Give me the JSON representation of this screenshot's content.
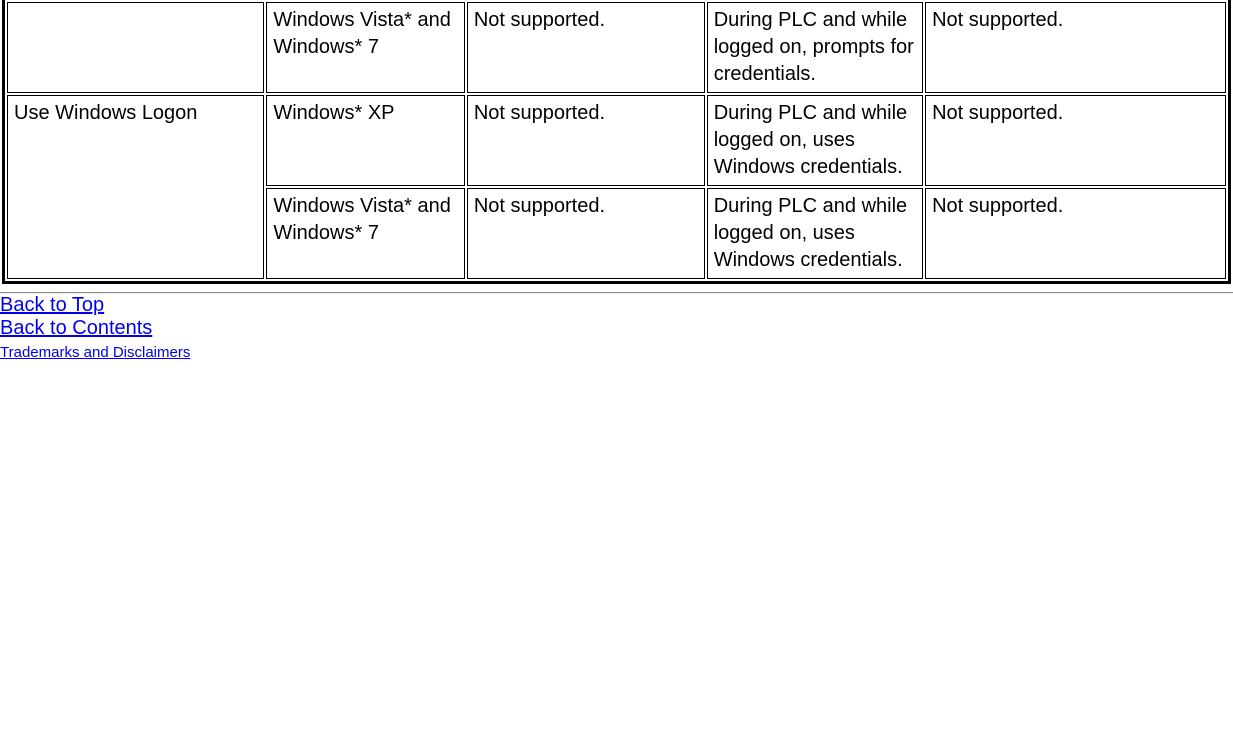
{
  "table": {
    "rows": [
      {
        "c0": "",
        "c1": "Windows Vista* and Windows* 7",
        "c2": "Not supported.",
        "c3": "During PLC and while logged on, prompts for credentials.",
        "c4": "Not supported."
      },
      {
        "c0": "Use Windows Logon",
        "c1": "Windows* XP",
        "c2": "Not supported.",
        "c3": "During PLC and while logged on, uses Windows credentials.",
        "c4": "Not supported."
      },
      {
        "c1": "Windows Vista* and Windows* 7",
        "c2": "Not supported.",
        "c3": "During PLC and while logged on, uses Windows credentials.",
        "c4": "Not supported."
      }
    ]
  },
  "links": {
    "back_to_top": "Back to Top",
    "back_to_contents": "Back to Contents",
    "trademarks": "Trademarks and Disclaimers"
  }
}
